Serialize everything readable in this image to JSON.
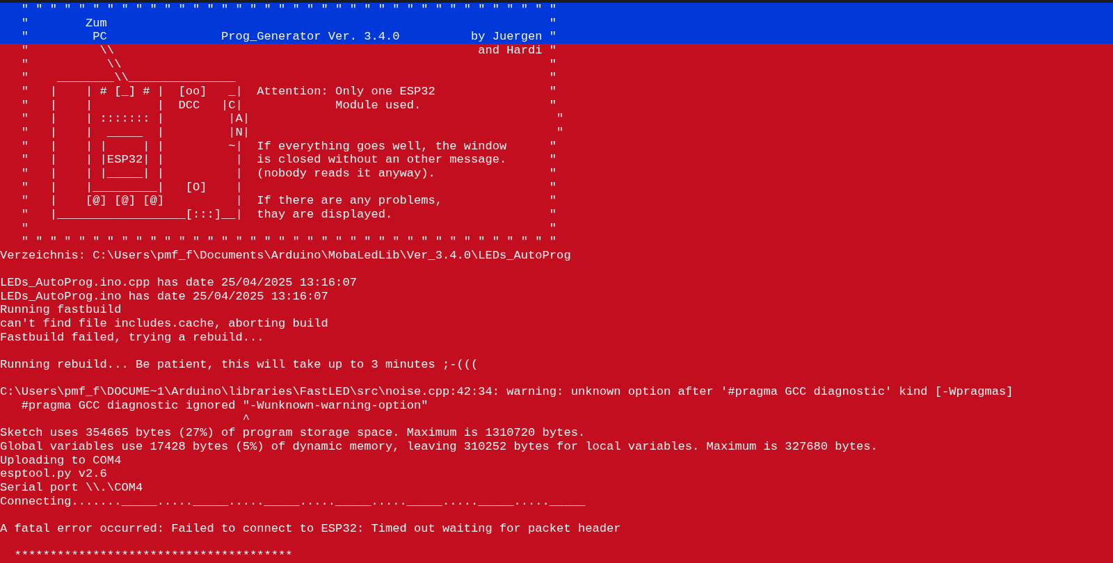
{
  "console": {
    "banner": [
      "   \" \" \" \" \" \" \" \" \" \" \" \" \" \" \" \" \" \" \" \" \" \" \" \" \" \" \" \" \" \" \" \" \" \" \" \" \" \"",
      "   \"        Zum                                                              \"",
      "   \"         PC                Prog_Generator Ver. 3.4.0          by Juergen \""
    ],
    "blocks": [
      [
        "   \"          \\\\                                                   and Hardi \"",
        "   \"           \\\\                                                            \"",
        "   \"    ________\\\\_______________                                            \"",
        "   \"   |    | # [_] # |  [oo]   _|  Attention: Only one ESP32                \"",
        "   \"   |    |         |  DCC   |C|             Module used.                  \"",
        "   \"   |    | ::::::: |         |A|                                           \"",
        "   \"   |    |  _____  |         |N|                                           \"",
        "   \"   |    | |     | |         ~|  If everything goes well, the window      \"",
        "   \"   |    | |ESP32| |          |  is closed without an other message.      \"",
        "   \"   |    | |_____| |          |  (nobody reads it anyway).                \"",
        "   \"   |    |_________|   [O]    |                                           \"",
        "   \"   |    [@] [@] [@]          |  If there are any problems,               \"",
        "   \"   |__________________[:::]__|  thay are displayed.                      \"",
        "   \"                                                                         \"",
        "   \" \" \" \" \" \" \" \" \" \" \" \" \" \" \" \" \" \" \" \" \" \" \" \" \" \" \" \" \" \" \" \" \" \" \" \" \" \"",
        "Verzeichnis: C:\\Users\\pmf_f\\Documents\\Arduino\\MobaLedLib\\Ver_3.4.0\\LEDs_AutoProg"
      ],
      [
        "LEDs_AutoProg.ino.cpp has date 25/04/2025 13:16:07",
        "LEDs_AutoProg.ino has date 25/04/2025 13:16:07",
        "Running fastbuild",
        "can't find file includes.cache, aborting build",
        "Fastbuild failed, trying a rebuild..."
      ],
      [
        "Running rebuild... Be patient, this will take up to 3 minutes ;-((("
      ],
      [
        "C:\\Users\\pmf_f\\DOCUME~1\\Arduino\\libraries\\FastLED\\src\\noise.cpp:42:34: warning: unknown option after '#pragma GCC diagnostic' kind [-Wpragmas]",
        "   #pragma GCC diagnostic ignored \"-Wunknown-warning-option\"",
        "                                  ^",
        "Sketch uses 354665 bytes (27%) of program storage space. Maximum is 1310720 bytes.",
        "Global variables use 17428 bytes (5%) of dynamic memory, leaving 310252 bytes for local variables. Maximum is 327680 bytes.",
        "Uploading to COM4",
        "esptool.py v2.6",
        "Serial port \\\\.\\COM4",
        "Connecting......._____....._____....._____....._____....._____....._____....._____"
      ],
      [
        "A fatal error occurred: Failed to connect to ESP32: Timed out waiting for packet header"
      ],
      [
        "  ***************************************"
      ]
    ]
  }
}
